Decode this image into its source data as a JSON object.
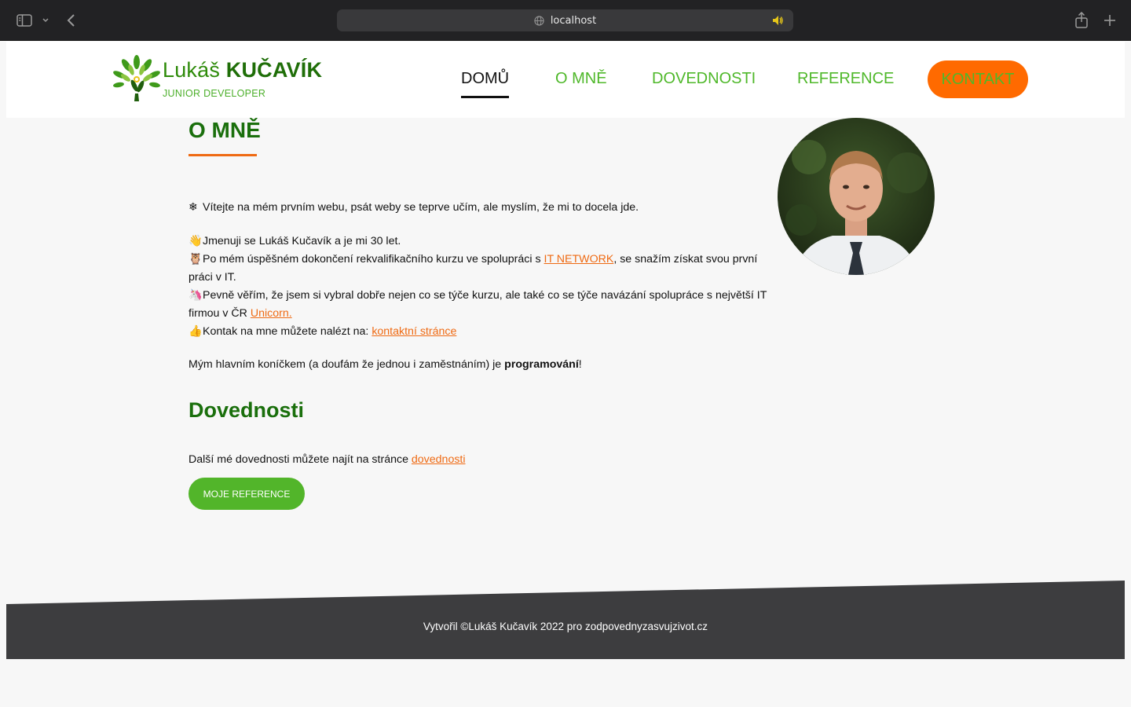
{
  "browser": {
    "address": "localhost",
    "icons": [
      "sidebar-icon",
      "chevron-down-icon",
      "back-icon",
      "globe-icon",
      "speaker-icon",
      "share-icon",
      "plus-icon"
    ]
  },
  "header": {
    "brand_first": "Lukáš",
    "brand_last": "KUČAVÍK",
    "brand_sub": "JUNIOR DEVELOPER",
    "nav": {
      "home": "DOMŮ",
      "about": "O MNĚ",
      "skills": "DOVEDNOSTI",
      "references": "REFERENCE",
      "contact": "KONTAKT"
    }
  },
  "about": {
    "heading": "O MNĚ",
    "welcome": "Vítejte na mém prvním webu, psát weby se teprve učím, ale myslím, že mi to docela jde.",
    "line_name": "Jmenuji se Lukáš Kučavík a je mi 30 let.",
    "line_course_a": "Po mém úspěšném dokončení rekvalifikačního kurzu ve spolupráci s ",
    "line_course_link": "IT NETWORK",
    "line_course_b": ", se snažím získat svou první práci v IT.",
    "line_belief_a": "Pevně věřím, že jsem si vybral dobře nejen co se týče kurzu, ale také co se týče navázání spolupráce s největší IT firmou v ČR ",
    "line_belief_link": "Unicorn.",
    "line_contact_a": "Kontak na mne můžete nalézt na: ",
    "line_contact_link": "kontaktní stránce",
    "hobby_a": "Mým hlavním koníčkem (a doufám že jednou i zaměstnáním) je ",
    "hobby_bold": "programování",
    "hobby_b": "!"
  },
  "skills": {
    "heading": "Dovednosti",
    "text_a": "Další mé dovednosti můžete najít na stránce ",
    "text_link": "dovednosti",
    "button": "MOJE REFERENCE"
  },
  "footer": {
    "text": "Vytvořil ©Lukáš Kučavík 2022 pro zodpovednyzasvujzivot.cz"
  },
  "colors": {
    "accent_green": "#4fb82a",
    "dark_green": "#1a6f0c",
    "orange": "#ff6a00",
    "link_orange": "#ef6a13",
    "footer_bg": "#3d3d3f"
  }
}
